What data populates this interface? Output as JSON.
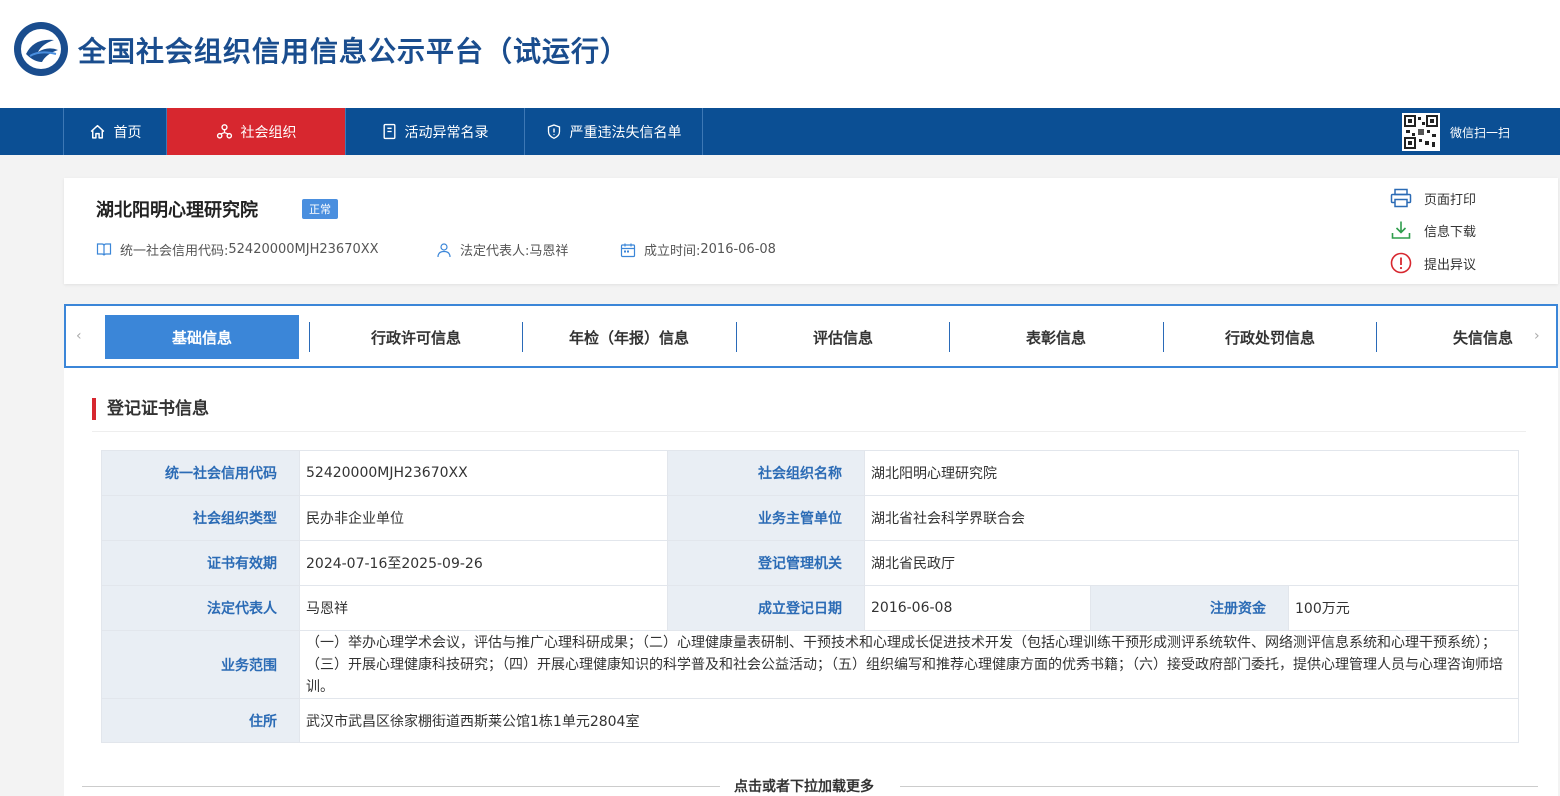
{
  "header": {
    "site_title": "全国社会组织信用信息公示平台（试运行）",
    "logo_icon": "national-social-org-logo"
  },
  "nav": {
    "items": [
      {
        "label": "首页",
        "icon": "home-icon",
        "active": false
      },
      {
        "label": "社会组织",
        "icon": "org-icon",
        "active": true
      },
      {
        "label": "活动异常名录",
        "icon": "document-icon",
        "active": false
      },
      {
        "label": "严重违法失信名单",
        "icon": "shield-icon",
        "active": false
      }
    ],
    "wechat_label": "微信扫一扫",
    "colors": {
      "bar": "#0b4f94",
      "active": "#d7272f"
    }
  },
  "org": {
    "name": "湖北阳明心理研究院",
    "status": "正常",
    "credit_code_label": "统一社会信用代码: ",
    "credit_code": "52420000MJH23670XX",
    "rep_label": "法定代表人: ",
    "rep": "马恩祥",
    "founded_label": "成立时间: ",
    "founded": "2016-06-08",
    "actions": {
      "print": "页面打印",
      "download": "信息下载",
      "objection": "提出异议"
    }
  },
  "tabs": [
    "基础信息",
    "行政许可信息",
    "年检（年报）信息",
    "评估信息",
    "表彰信息",
    "行政处罚信息",
    "失信信息"
  ],
  "tab_arrows": {
    "left": "‹",
    "right": "›"
  },
  "section": {
    "title": "登记证书信息"
  },
  "table": {
    "credit_code_label": "统一社会信用代码",
    "credit_code": "52420000MJH23670XX",
    "org_name_label": "社会组织名称",
    "org_name": "湖北阳明心理研究院",
    "type_label": "社会组织类型",
    "type": "民办非企业单位",
    "supervisor_label": "业务主管单位",
    "supervisor": "湖北省社会科学界联合会",
    "validity_label": "证书有效期",
    "validity": "2024-07-16至2025-09-26",
    "registrar_label": "登记管理机关",
    "registrar": "湖北省民政厅",
    "rep_label": "法定代表人",
    "rep": "马恩祥",
    "reg_date_label": "成立登记日期",
    "reg_date": "2016-06-08",
    "capital_label": "注册资金",
    "capital": "100万元",
    "scope_label": "业务范围",
    "scope": "（一）举办心理学术会议，评估与推广心理科研成果；（二）心理健康量表研制、干预技术和心理成长促进技术开发（包括心理训练干预形成测评系统软件、网络测评信息系统和心理干预系统）；（三）开展心理健康科技研究；（四）开展心理健康知识的科学普及和社会公益活动；（五）组织编写和推荐心理健康方面的优秀书籍；（六）接受政府部门委托，提供心理管理人员与心理咨询师培训。",
    "address_label": "住所",
    "address": "武汉市武昌区徐家棚街道西斯莱公馆1栋1单元2804室"
  },
  "load_more": "点击或者下拉加载更多"
}
